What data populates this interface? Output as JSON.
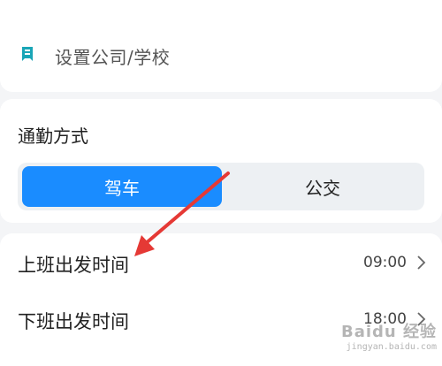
{
  "company": {
    "label": "设置公司/学校",
    "icon": "building-icon",
    "icon_color": "#1aa6b7"
  },
  "commute": {
    "title": "通勤方式",
    "options": [
      "驾车",
      "公交"
    ],
    "selected": "驾车",
    "accent": "#1a8cff"
  },
  "times": {
    "depart": {
      "label": "上班出发时间",
      "value": "09:00"
    },
    "return": {
      "label": "下班出发时间",
      "value": "18:00"
    }
  },
  "annotation": {
    "arrow_color": "#e53935"
  },
  "watermark": {
    "main": "Baidu 经验",
    "sub": "jingyan.baidu.com"
  }
}
